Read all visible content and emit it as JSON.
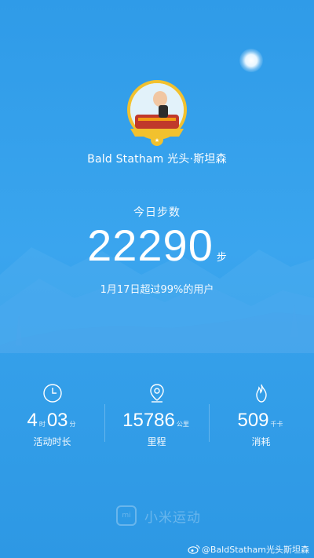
{
  "profile": {
    "name": "Bald Statham 光头·斯坦森"
  },
  "steps": {
    "label": "今日步数",
    "value": "22290",
    "unit": "步",
    "rank_text": "1月17日超过99%的用户"
  },
  "stats": [
    {
      "icon": "clock-icon",
      "hours": "4",
      "hours_unit": "时",
      "minutes": "03",
      "minutes_unit": "分",
      "label": "活动时长"
    },
    {
      "icon": "location-pin-icon",
      "value": "15786",
      "unit": "公里",
      "label": "里程"
    },
    {
      "icon": "flame-icon",
      "value": "509",
      "unit": "千卡",
      "label": "消耗"
    }
  ],
  "brand": {
    "logo_text": "mi",
    "name": "小米运动"
  },
  "watermark": {
    "icon": "weibo-icon",
    "text": "@BaldStatham光头斯坦森"
  },
  "colors": {
    "background": "#2f9be8",
    "text": "#ffffff"
  }
}
